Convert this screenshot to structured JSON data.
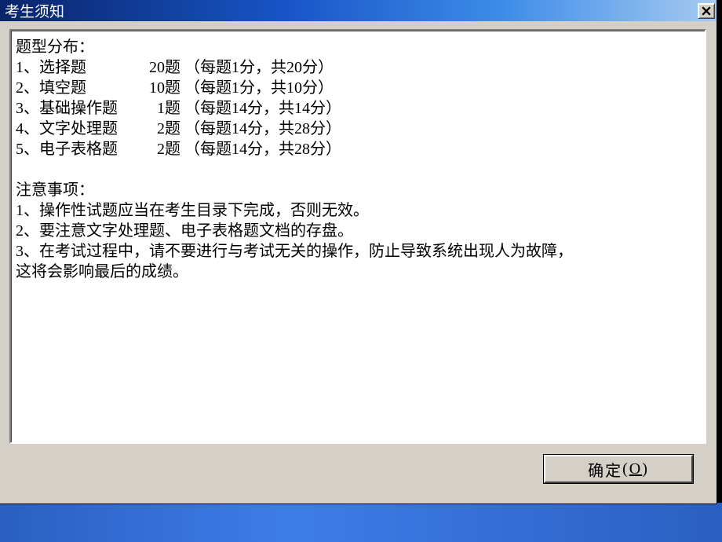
{
  "dialog": {
    "title": "考生须知",
    "close_icon": "close-icon"
  },
  "content": {
    "section1_header": "题型分布：",
    "rows": [
      {
        "num": "1、",
        "name": "选择题",
        "count": "20题",
        "detail": "（每题1分，共20分）"
      },
      {
        "num": "2、",
        "name": "填空题",
        "count": "10题",
        "detail": "（每题1分，共10分）"
      },
      {
        "num": "3、",
        "name": "基础操作题",
        "count": "1题",
        "detail": "（每题14分，共14分）"
      },
      {
        "num": "4、",
        "name": "文字处理题",
        "count": "2题",
        "detail": "（每题14分，共28分）"
      },
      {
        "num": "5、",
        "name": "电子表格题",
        "count": "2题",
        "detail": "（每题14分，共28分）"
      }
    ],
    "section2_header": "注意事项：",
    "notes": [
      "1、操作性试题应当在考生目录下完成，否则无效。",
      "2、要注意文字处理题、电子表格题文档的存盘。",
      "3、在考试过程中，请不要进行与考试无关的操作，防止导致系统出现人为故障，\n这将会影响最后的成绩。"
    ]
  },
  "buttons": {
    "ok_label": "确定",
    "ok_accel": "O"
  }
}
